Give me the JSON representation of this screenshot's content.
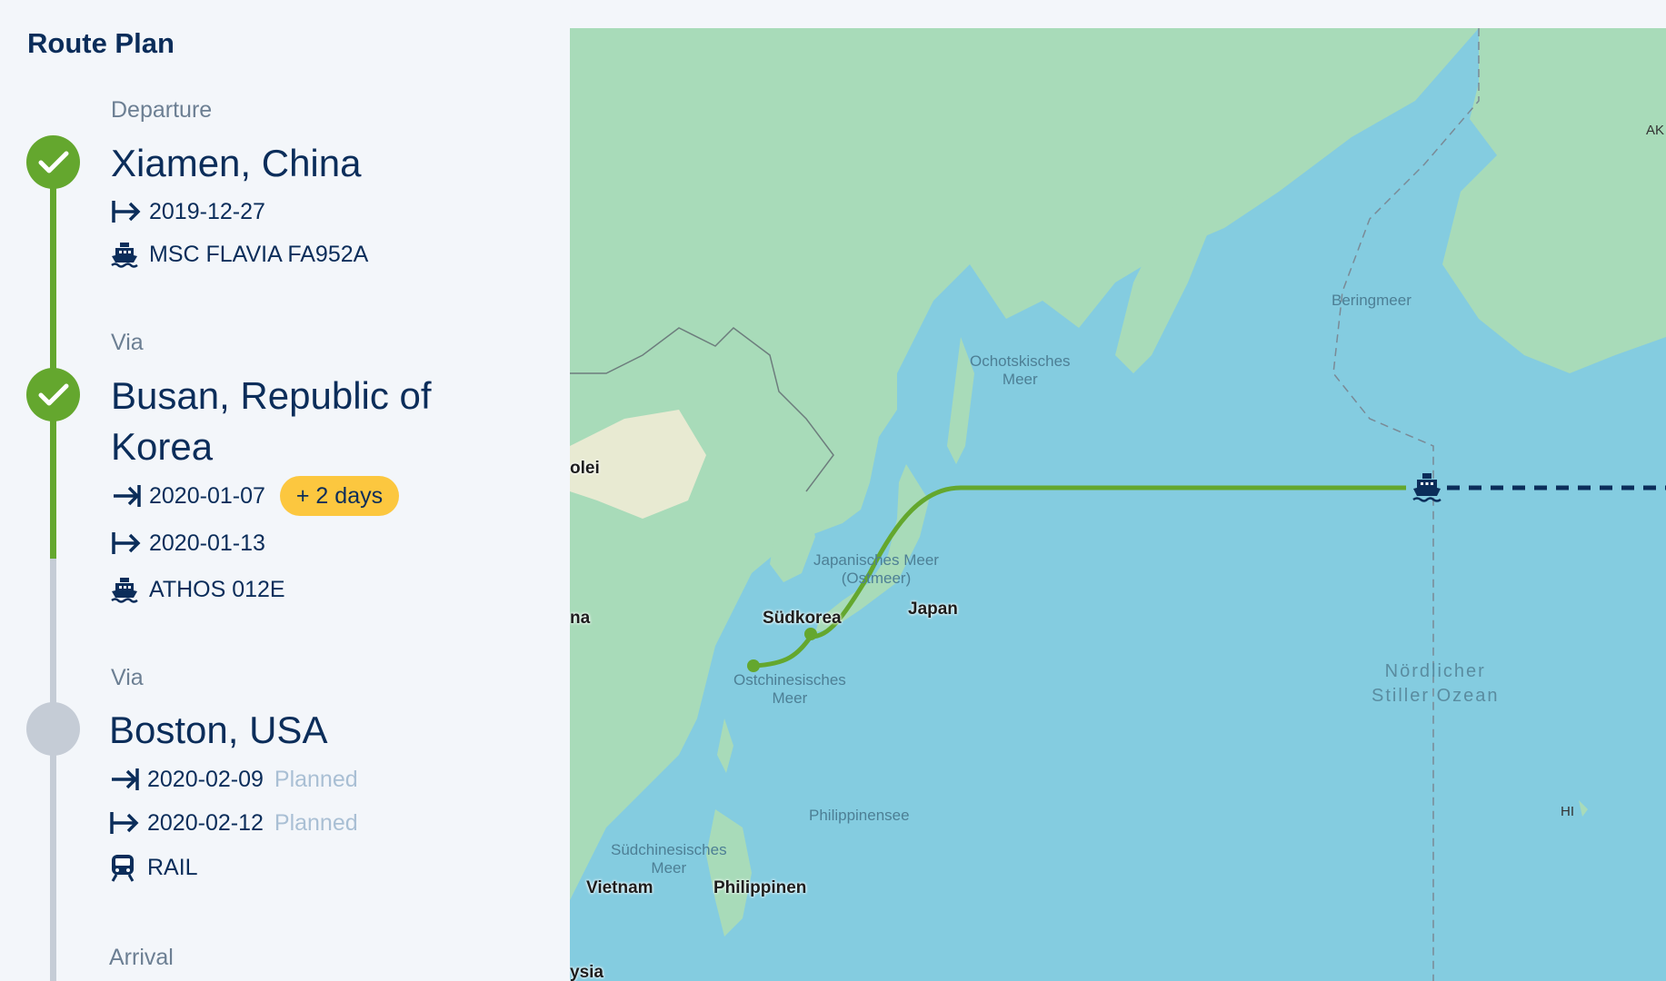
{
  "page": {
    "title": "Route Plan"
  },
  "colors": {
    "done": "#64a72e",
    "pending": "#c5ccd6",
    "navy": "#0b2d5a",
    "delay": "#fcc73f",
    "sea": "#84cce0",
    "land": "#a8dbb9"
  },
  "route": {
    "departure": {
      "label": "Departure",
      "place": "Xiamen, China",
      "status": "done",
      "depart_date": "2019-12-27",
      "transport_icon": "ship-icon",
      "transport": "MSC FLAVIA FA952A"
    },
    "via1": {
      "label": "Via",
      "place": "Busan, Republic of Korea",
      "status": "done",
      "arrive_date": "2020-01-07",
      "delay": "+ 2 days",
      "depart_date": "2020-01-13",
      "transport_icon": "ship-icon",
      "transport": "ATHOS 012E"
    },
    "via2": {
      "label": "Via",
      "place": "Boston, USA",
      "status": "pending",
      "arrive_date": "2020-02-09",
      "arrive_status": "Planned",
      "depart_date": "2020-02-12",
      "depart_status": "Planned",
      "transport_icon": "train-icon",
      "transport": "RAIL"
    },
    "arrival": {
      "label": "Arrival"
    }
  },
  "map": {
    "labels": {
      "ochotsk": "Ochotskisches\nMeer",
      "bering": "Beringmeer",
      "japan_sea": "Japanisches Meer\n(Ostmeer)",
      "east_china_sea": "Ostchinesisches\nMeer",
      "philippine_sea": "Philippinensee",
      "south_china_sea": "Südchinesisches\nMeer",
      "pacific": "Nördlicher\nStiller Ozean",
      "south_korea": "Südkorea",
      "japan": "Japan",
      "vietnam": "Vietnam",
      "philippines": "Philippinen",
      "mongolia_partial": "olei",
      "china_partial": "na",
      "malaysia_partial": "ysia",
      "ak": "AK",
      "hi": "HI"
    }
  }
}
